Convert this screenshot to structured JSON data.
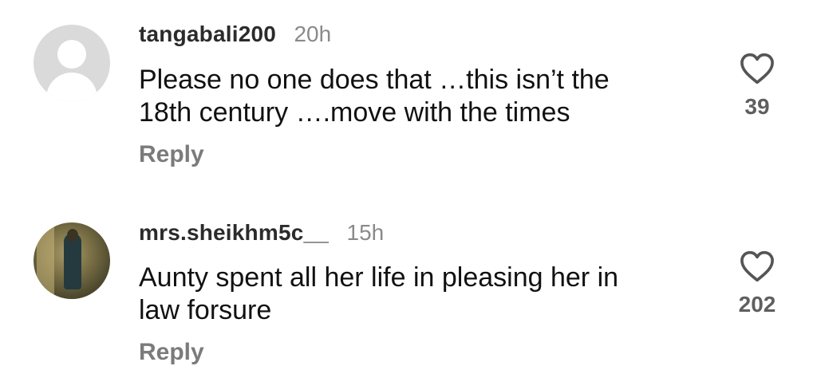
{
  "comments": [
    {
      "username": "tangabali200",
      "time": "20h",
      "line1": "Please no one does that …this isn’t the",
      "line2": "18th century ….move with the times",
      "reply_label": "Reply",
      "like_count": "39",
      "avatar_icon": "default-avatar-icon"
    },
    {
      "username": "mrs.sheikhm5c__",
      "time": "15h",
      "line1": "Aunty spent all her life in pleasing her in",
      "line2": "law forsure",
      "reply_label": "Reply",
      "like_count": "202",
      "avatar_icon": "user-photo-avatar"
    }
  ]
}
